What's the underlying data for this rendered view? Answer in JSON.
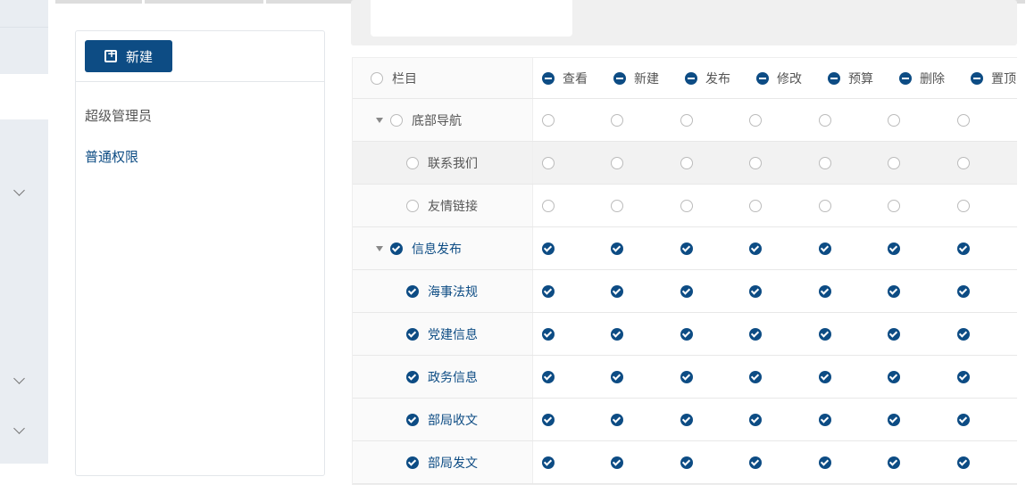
{
  "panel": {
    "new_button": "新建",
    "roles": [
      "超级管理员",
      "普通权限"
    ]
  },
  "table": {
    "header": {
      "label": "栏目",
      "perms": [
        "查看",
        "新建",
        "发布",
        "修改",
        "预算",
        "删除",
        "置顶"
      ]
    },
    "rows": [
      {
        "label": "底部导航",
        "level": 0,
        "expandable": true,
        "checked": false
      },
      {
        "label": "联系我们",
        "level": 1,
        "checked": false,
        "highlight": true
      },
      {
        "label": "友情链接",
        "level": 1,
        "checked": false
      },
      {
        "label": "信息发布",
        "level": 0,
        "expandable": true,
        "checked": true
      },
      {
        "label": "海事法规",
        "level": 1,
        "checked": true
      },
      {
        "label": "党建信息",
        "level": 1,
        "checked": true
      },
      {
        "label": "政务信息",
        "level": 1,
        "checked": true
      },
      {
        "label": "部局收文",
        "level": 1,
        "checked": true
      },
      {
        "label": "部局发文",
        "level": 1,
        "checked": true
      }
    ]
  },
  "colors": {
    "primary": "#0d4c84"
  }
}
